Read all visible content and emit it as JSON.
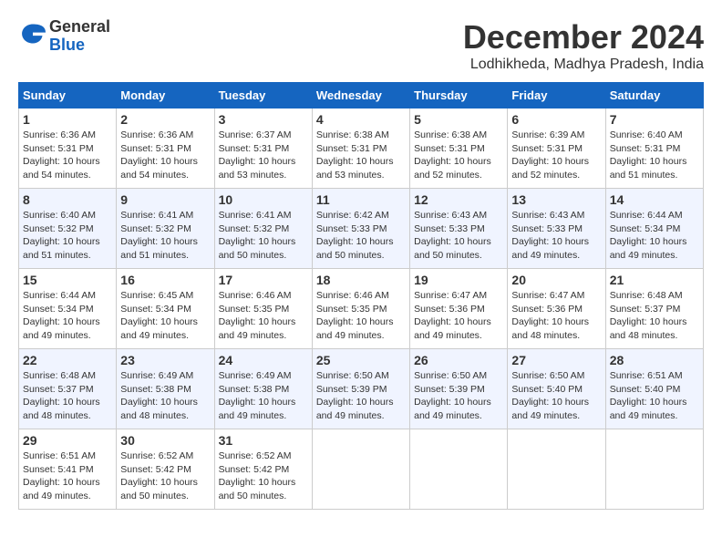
{
  "logo": {
    "general": "General",
    "blue": "Blue"
  },
  "title": "December 2024",
  "subtitle": "Lodhikheda, Madhya Pradesh, India",
  "headers": [
    "Sunday",
    "Monday",
    "Tuesday",
    "Wednesday",
    "Thursday",
    "Friday",
    "Saturday"
  ],
  "weeks": [
    {
      "shaded": false,
      "days": [
        {
          "num": "1",
          "sunrise": "Sunrise: 6:36 AM",
          "sunset": "Sunset: 5:31 PM",
          "daylight": "Daylight: 10 hours and 54 minutes."
        },
        {
          "num": "2",
          "sunrise": "Sunrise: 6:36 AM",
          "sunset": "Sunset: 5:31 PM",
          "daylight": "Daylight: 10 hours and 54 minutes."
        },
        {
          "num": "3",
          "sunrise": "Sunrise: 6:37 AM",
          "sunset": "Sunset: 5:31 PM",
          "daylight": "Daylight: 10 hours and 53 minutes."
        },
        {
          "num": "4",
          "sunrise": "Sunrise: 6:38 AM",
          "sunset": "Sunset: 5:31 PM",
          "daylight": "Daylight: 10 hours and 53 minutes."
        },
        {
          "num": "5",
          "sunrise": "Sunrise: 6:38 AM",
          "sunset": "Sunset: 5:31 PM",
          "daylight": "Daylight: 10 hours and 52 minutes."
        },
        {
          "num": "6",
          "sunrise": "Sunrise: 6:39 AM",
          "sunset": "Sunset: 5:31 PM",
          "daylight": "Daylight: 10 hours and 52 minutes."
        },
        {
          "num": "7",
          "sunrise": "Sunrise: 6:40 AM",
          "sunset": "Sunset: 5:31 PM",
          "daylight": "Daylight: 10 hours and 51 minutes."
        }
      ]
    },
    {
      "shaded": true,
      "days": [
        {
          "num": "8",
          "sunrise": "Sunrise: 6:40 AM",
          "sunset": "Sunset: 5:32 PM",
          "daylight": "Daylight: 10 hours and 51 minutes."
        },
        {
          "num": "9",
          "sunrise": "Sunrise: 6:41 AM",
          "sunset": "Sunset: 5:32 PM",
          "daylight": "Daylight: 10 hours and 51 minutes."
        },
        {
          "num": "10",
          "sunrise": "Sunrise: 6:41 AM",
          "sunset": "Sunset: 5:32 PM",
          "daylight": "Daylight: 10 hours and 50 minutes."
        },
        {
          "num": "11",
          "sunrise": "Sunrise: 6:42 AM",
          "sunset": "Sunset: 5:33 PM",
          "daylight": "Daylight: 10 hours and 50 minutes."
        },
        {
          "num": "12",
          "sunrise": "Sunrise: 6:43 AM",
          "sunset": "Sunset: 5:33 PM",
          "daylight": "Daylight: 10 hours and 50 minutes."
        },
        {
          "num": "13",
          "sunrise": "Sunrise: 6:43 AM",
          "sunset": "Sunset: 5:33 PM",
          "daylight": "Daylight: 10 hours and 49 minutes."
        },
        {
          "num": "14",
          "sunrise": "Sunrise: 6:44 AM",
          "sunset": "Sunset: 5:34 PM",
          "daylight": "Daylight: 10 hours and 49 minutes."
        }
      ]
    },
    {
      "shaded": false,
      "days": [
        {
          "num": "15",
          "sunrise": "Sunrise: 6:44 AM",
          "sunset": "Sunset: 5:34 PM",
          "daylight": "Daylight: 10 hours and 49 minutes."
        },
        {
          "num": "16",
          "sunrise": "Sunrise: 6:45 AM",
          "sunset": "Sunset: 5:34 PM",
          "daylight": "Daylight: 10 hours and 49 minutes."
        },
        {
          "num": "17",
          "sunrise": "Sunrise: 6:46 AM",
          "sunset": "Sunset: 5:35 PM",
          "daylight": "Daylight: 10 hours and 49 minutes."
        },
        {
          "num": "18",
          "sunrise": "Sunrise: 6:46 AM",
          "sunset": "Sunset: 5:35 PM",
          "daylight": "Daylight: 10 hours and 49 minutes."
        },
        {
          "num": "19",
          "sunrise": "Sunrise: 6:47 AM",
          "sunset": "Sunset: 5:36 PM",
          "daylight": "Daylight: 10 hours and 49 minutes."
        },
        {
          "num": "20",
          "sunrise": "Sunrise: 6:47 AM",
          "sunset": "Sunset: 5:36 PM",
          "daylight": "Daylight: 10 hours and 48 minutes."
        },
        {
          "num": "21",
          "sunrise": "Sunrise: 6:48 AM",
          "sunset": "Sunset: 5:37 PM",
          "daylight": "Daylight: 10 hours and 48 minutes."
        }
      ]
    },
    {
      "shaded": true,
      "days": [
        {
          "num": "22",
          "sunrise": "Sunrise: 6:48 AM",
          "sunset": "Sunset: 5:37 PM",
          "daylight": "Daylight: 10 hours and 48 minutes."
        },
        {
          "num": "23",
          "sunrise": "Sunrise: 6:49 AM",
          "sunset": "Sunset: 5:38 PM",
          "daylight": "Daylight: 10 hours and 48 minutes."
        },
        {
          "num": "24",
          "sunrise": "Sunrise: 6:49 AM",
          "sunset": "Sunset: 5:38 PM",
          "daylight": "Daylight: 10 hours and 49 minutes."
        },
        {
          "num": "25",
          "sunrise": "Sunrise: 6:50 AM",
          "sunset": "Sunset: 5:39 PM",
          "daylight": "Daylight: 10 hours and 49 minutes."
        },
        {
          "num": "26",
          "sunrise": "Sunrise: 6:50 AM",
          "sunset": "Sunset: 5:39 PM",
          "daylight": "Daylight: 10 hours and 49 minutes."
        },
        {
          "num": "27",
          "sunrise": "Sunrise: 6:50 AM",
          "sunset": "Sunset: 5:40 PM",
          "daylight": "Daylight: 10 hours and 49 minutes."
        },
        {
          "num": "28",
          "sunrise": "Sunrise: 6:51 AM",
          "sunset": "Sunset: 5:40 PM",
          "daylight": "Daylight: 10 hours and 49 minutes."
        }
      ]
    },
    {
      "shaded": false,
      "days": [
        {
          "num": "29",
          "sunrise": "Sunrise: 6:51 AM",
          "sunset": "Sunset: 5:41 PM",
          "daylight": "Daylight: 10 hours and 49 minutes."
        },
        {
          "num": "30",
          "sunrise": "Sunrise: 6:52 AM",
          "sunset": "Sunset: 5:42 PM",
          "daylight": "Daylight: 10 hours and 50 minutes."
        },
        {
          "num": "31",
          "sunrise": "Sunrise: 6:52 AM",
          "sunset": "Sunset: 5:42 PM",
          "daylight": "Daylight: 10 hours and 50 minutes."
        },
        null,
        null,
        null,
        null
      ]
    }
  ]
}
